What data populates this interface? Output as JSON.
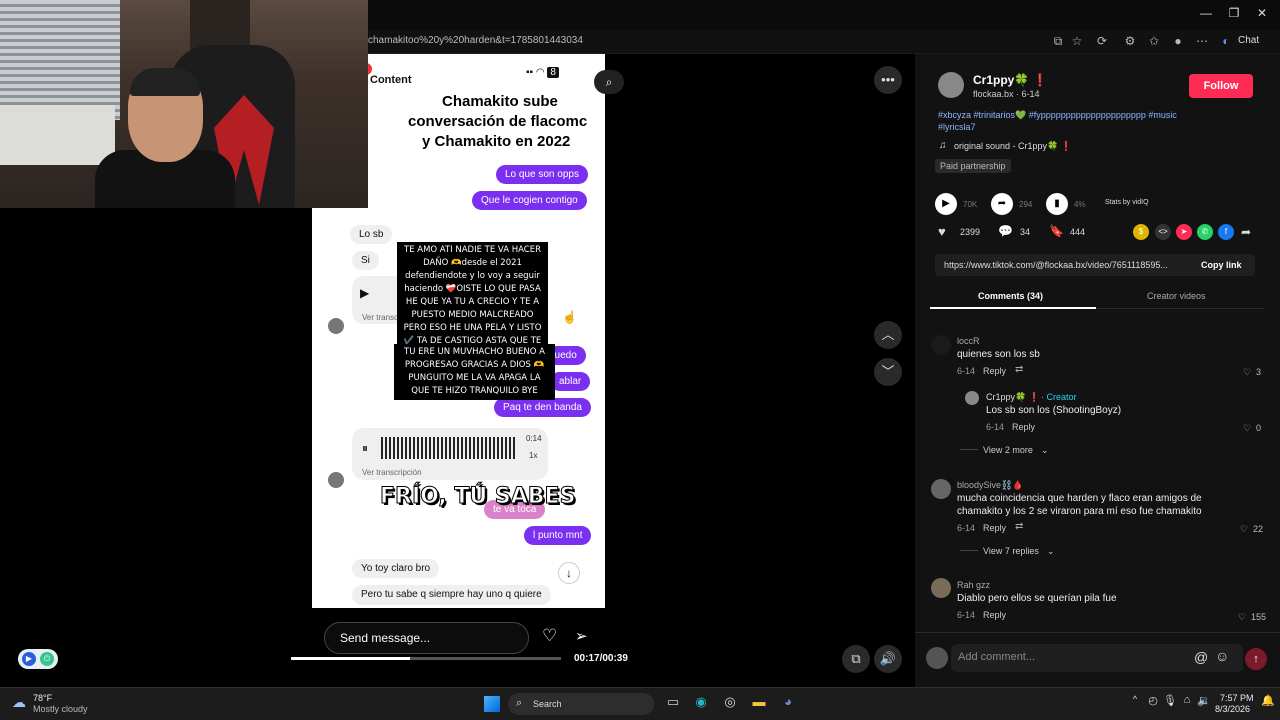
{
  "browser": {
    "url": "chamakitoo%20y%20harden&t=1785801443034",
    "chat_label": "Chat",
    "window_controls": [
      "—",
      "❐",
      "✕"
    ]
  },
  "video": {
    "content_label": "Content",
    "caption_title": "Chamakito sube conversación de flacomc y Chamakito en 2022",
    "caption_line1": "Chamakito sube",
    "caption_line2": "conversación de flacomc",
    "caption_line3": "y Chamakito en 2022",
    "black_caption_1": "TE AMO ATI NADIE TE VA HACER DAÑO 🫶desde el 2021 defendiendote y lo voy a seguir haciendo ❤️‍🩹OISTE LO QUE PASA HE QUE YA TU A CRECIO Y TE A PUESTO MEDIO MALCREADO PERO ESO HE UNA PELA Y LISTO ✔️ TA DE CASTIGO ASTA QUE TE PORTE BIEN",
    "black_caption_2": "TU ERE UN MUVHACHO BUENO A PROGRESAO GRACIAS A DIOS 🫶 PUNGUITO ME LA VA APAGA LA QUE TE HIZO TRANQUILO BYE",
    "overlay_caption": "FRÍO, TÚ SABES",
    "messages": {
      "out_1": "Lo que son opps",
      "out_2": "Que le cogien contigo",
      "in_1": "Lo sb",
      "in_2": "Si",
      "transcript_1": "Ver transcr",
      "out_3": "puedo",
      "out_4": "ablar",
      "out_5": "Paq te den banda",
      "transcript_2": "Ver transcripción",
      "audio_time": "0:14",
      "audio_speed": "1x",
      "out_6": "te va toca",
      "out_7": "l punto mnt",
      "in_3": "Yo toy claro bro",
      "in_4": "Pero tu sabe q siempre hay uno q quiere"
    },
    "send_placeholder": "Send message...",
    "time": "00:17/00:39",
    "progress": 0.44
  },
  "post": {
    "username": "Cr1ppy🍀 ❗",
    "handle_date": "flockaa.bx · 6-14",
    "follow_label": "Follow",
    "hashtags_line1": "#xbcyza #trinitarios💚 #fyppppppppppppppppppppp #music",
    "hashtags_line2": "#lyricsla7",
    "sound": "original sound - Cr1ppy🍀 ❗",
    "paid": "Paid partnership",
    "stat_plays": "70K",
    "stat_shares": "294",
    "stat_pct": "4%",
    "stats_by": "Stats by vidIQ",
    "likes": "2399",
    "comments": "34",
    "saves": "444",
    "link": "https://www.tiktok.com/@flockaa.bx/video/7651118595...",
    "copy_link": "Copy link",
    "tab_comments": "Comments (34)",
    "tab_creator": "Creator videos"
  },
  "comments": [
    {
      "user": "loccR",
      "text": "quienes son los sb",
      "date": "6-14",
      "reply": "Reply",
      "likes": "3"
    },
    {
      "user": "Cr1ppy🍀 ❗",
      "creator": "· Creator",
      "text": "Los sb son los (ShootingBoyz)",
      "date": "6-14",
      "reply": "Reply",
      "likes": "0"
    },
    {
      "user": "bloodySive⛓️🩸",
      "text1": "mucha coincidencia que harden y flaco eran amigos de",
      "text2": "chamakito y los 2 se viraron para mí eso fue chamakito",
      "date": "6-14",
      "reply": "Reply",
      "likes": "22"
    },
    {
      "user": "Rah gzz",
      "text": "Diablo pero ellos se querían pila fue",
      "date": "6-14",
      "reply": "Reply",
      "likes": "155"
    }
  ],
  "view_more_1": "View 2 more",
  "view_more_2": "View 7 replies",
  "add_comment_placeholder": "Add comment...",
  "taskbar": {
    "weather_temp": "78°F",
    "weather_desc": "Mostly cloudy",
    "search_label": "Search",
    "clock_time": "7:57 PM",
    "clock_date": "8/3/2026"
  },
  "colors": {
    "follow": "#fe2c55",
    "bubble": "#7b2ff0",
    "creator": "#20d5ec"
  }
}
